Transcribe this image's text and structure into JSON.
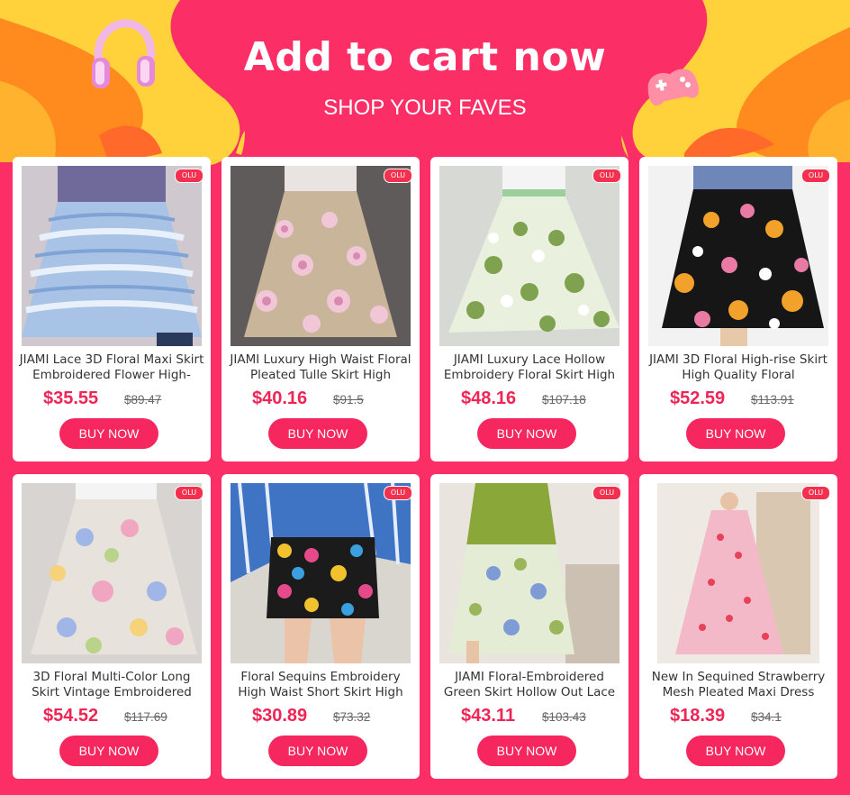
{
  "header": {
    "title": "Add to cart now",
    "subtitle": "SHOP YOUR FAVES"
  },
  "colors": {
    "background": "#fb2e66",
    "price": "#ee2555",
    "button": "#f6265e",
    "swirl_yellow": "#ffd23c",
    "swirl_orange": "#ff8a1e"
  },
  "decorations": [
    "headphones-icon",
    "gamepad-icon",
    "leaf-icon"
  ],
  "products": [
    {
      "title": "JIAMI Lace 3D Floral Maxi Skirt Embroidered Flower High-",
      "price": "$35.55",
      "original_price": "$89.47",
      "button": "BUY NOW",
      "badge": "OLU",
      "image": "blue-lace-maxi-skirt"
    },
    {
      "title": "JIAMI Luxury High Waist Floral Pleated Tulle Skirt High",
      "price": "$40.16",
      "original_price": "$91.5",
      "button": "BUY NOW",
      "badge": "OLU",
      "image": "pink-floral-tulle-skirt"
    },
    {
      "title": "JIAMI Luxury Lace Hollow Embroidery Floral Skirt High",
      "price": "$48.16",
      "original_price": "$107.18",
      "button": "BUY NOW",
      "badge": "OLU",
      "image": "green-lace-floral-skirt"
    },
    {
      "title": "JIAMI 3D Floral High-rise Skirt High Quality Floral",
      "price": "$52.59",
      "original_price": "$113.91",
      "button": "BUY NOW",
      "badge": "OLU",
      "image": "black-floral-skirt"
    },
    {
      "title": "3D Floral Multi-Color Long Skirt Vintage Embroidered",
      "price": "$54.52",
      "original_price": "$117.69",
      "button": "BUY NOW",
      "badge": "OLU",
      "image": "multicolor-floral-skirt"
    },
    {
      "title": "Floral Sequins Embroidery High Waist Short Skirt High",
      "price": "$30.89",
      "original_price": "$73.32",
      "button": "BUY NOW",
      "badge": "OLU",
      "image": "sequin-floral-mini-skirt"
    },
    {
      "title": "JIAMI Floral-Embroidered Green Skirt Hollow Out Lace",
      "price": "$43.11",
      "original_price": "$103.43",
      "button": "BUY NOW",
      "badge": "OLU",
      "image": "green-embroidered-skirt"
    },
    {
      "title": "New In Sequined Strawberry Mesh Pleated Maxi Dress",
      "price": "$18.39",
      "original_price": "$34.1",
      "button": "BUY NOW",
      "badge": "OLU",
      "image": "strawberry-maxi-dress"
    }
  ]
}
